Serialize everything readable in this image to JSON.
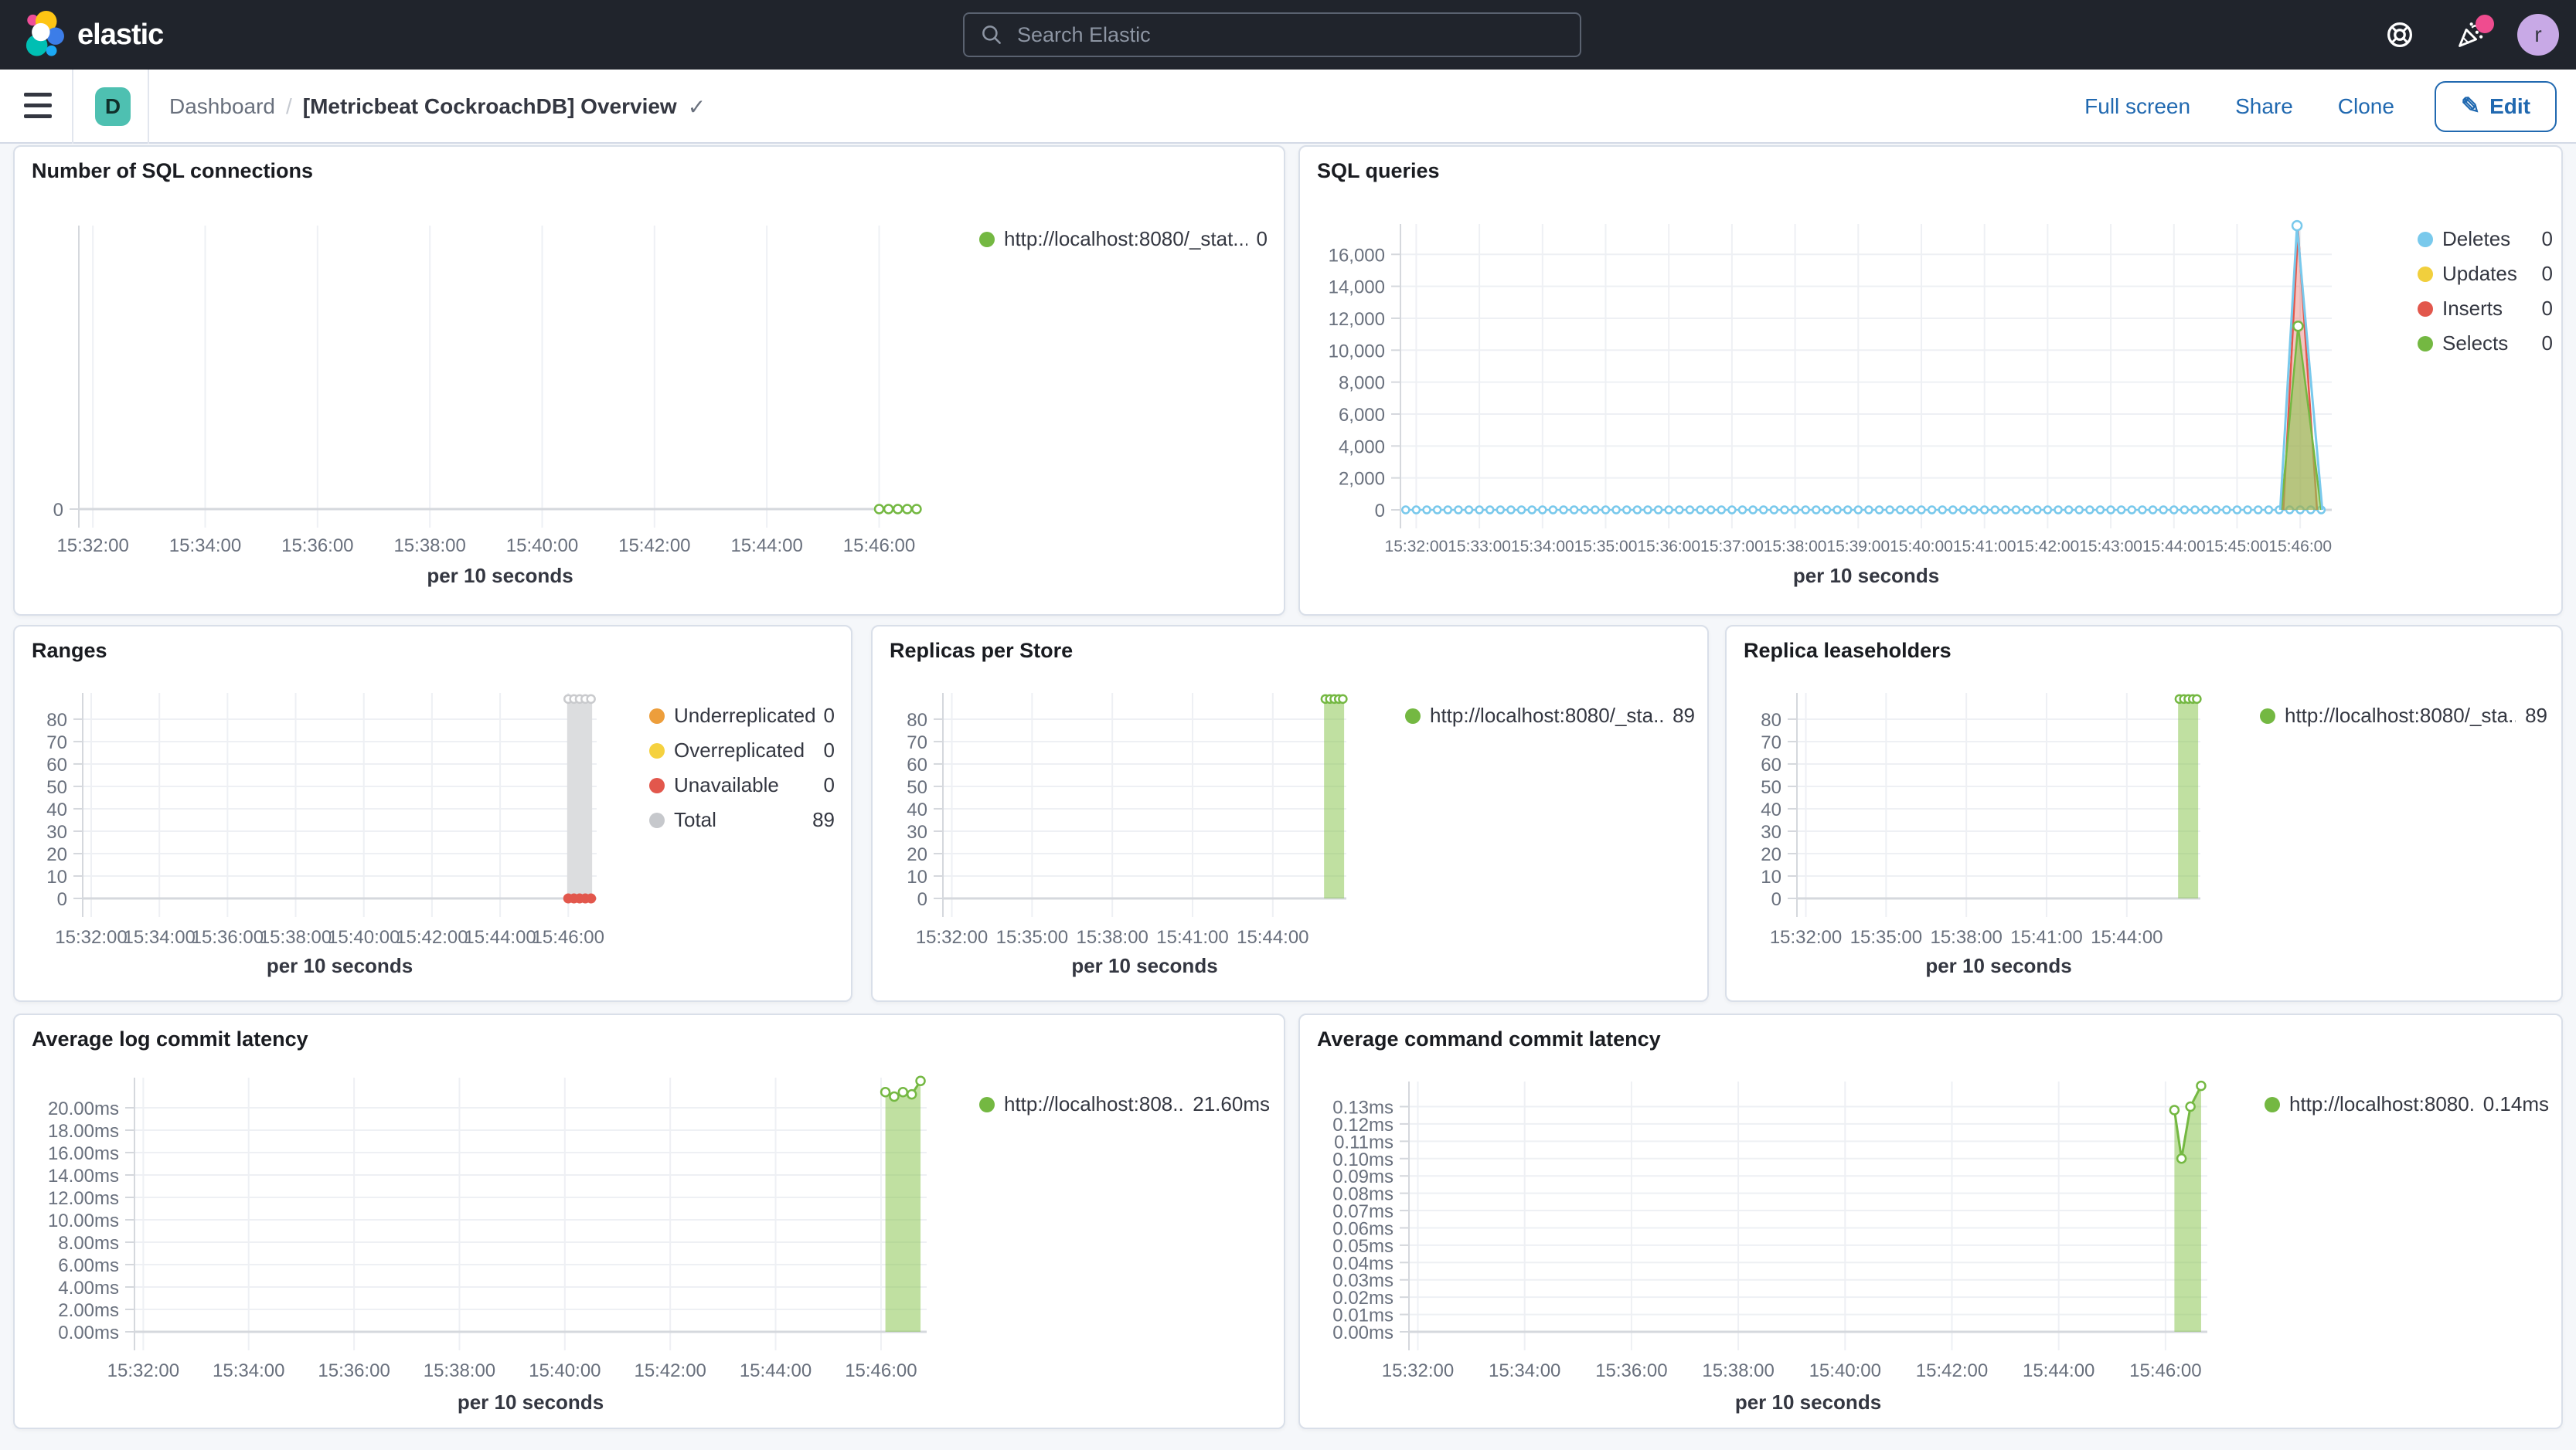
{
  "header": {
    "brand": "elastic",
    "search_placeholder": "Search Elastic",
    "avatar_initial": "r"
  },
  "toolbar": {
    "space_initial": "D",
    "breadcrumb_root": "Dashboard",
    "breadcrumb_sep": "/",
    "title": "[Metricbeat CockroachDB] Overview",
    "title_check": "✓",
    "full_screen_label": "Full screen",
    "share_label": "Share",
    "clone_label": "Clone",
    "edit_label": "Edit"
  },
  "panels": [
    {
      "id": "p-sql-conn",
      "title": "Number of SQL connections",
      "x_axis_title": "per 10 seconds",
      "legend": [
        {
          "color": "#74b842",
          "label": "http://localhost:8080/_stat...",
          "value": "0"
        }
      ],
      "chart_data": {
        "type": "line",
        "x_domain": [
          "15:31:45",
          "15:46:45"
        ],
        "x_ticks": [
          "15:32:00",
          "15:34:00",
          "15:36:00",
          "15:38:00",
          "15:40:00",
          "15:42:00",
          "15:44:00",
          "15:46:00"
        ],
        "y_domain": [
          0,
          1
        ],
        "y_ticks": [
          {
            "label": "0",
            "v": 0
          }
        ],
        "series": [
          {
            "kind": "line",
            "color": "#74b842",
            "width": 3,
            "markers": true,
            "open": true,
            "points": [
              [
                "15:46:00",
                0
              ],
              [
                "15:46:10",
                0
              ],
              [
                "15:46:20",
                0
              ],
              [
                "15:46:30",
                0
              ],
              [
                "15:46:40",
                0
              ]
            ]
          }
        ]
      }
    },
    {
      "id": "p-sql-queries",
      "title": "SQL queries",
      "x_axis_title": "per 10 seconds",
      "legend": [
        {
          "color": "#79c9ec",
          "label": "Deletes",
          "value": "0"
        },
        {
          "color": "#f1cf3d",
          "label": "Updates",
          "value": "0"
        },
        {
          "color": "#e2574c",
          "label": "Inserts",
          "value": "0"
        },
        {
          "color": "#74b842",
          "label": "Selects",
          "value": "0"
        }
      ],
      "chart_data": {
        "type": "line",
        "x_domain": [
          "15:31:45",
          "15:46:30"
        ],
        "x_ticks": [
          "15:32:00",
          "15:33:00",
          "15:34:00",
          "15:35:00",
          "15:36:00",
          "15:37:00",
          "15:38:00",
          "15:39:00",
          "15:40:00",
          "15:41:00",
          "15:42:00",
          "15:43:00",
          "15:44:00",
          "15:45:00",
          "15:46:00"
        ],
        "y_domain": [
          0,
          17900
        ],
        "y_ticks": [
          {
            "label": "0",
            "v": 0
          },
          {
            "label": "2,000",
            "v": 2000
          },
          {
            "label": "4,000",
            "v": 4000
          },
          {
            "label": "6,000",
            "v": 6000
          },
          {
            "label": "8,000",
            "v": 8000
          },
          {
            "label": "10,000",
            "v": 10000
          },
          {
            "label": "12,000",
            "v": 12000
          },
          {
            "label": "14,000",
            "v": 14000
          },
          {
            "label": "16,000",
            "v": 16000
          }
        ],
        "series": [
          {
            "kind": "zero-dots",
            "color": "#79c9ec",
            "from": "15:31:50",
            "to": "15:46:20",
            "step": 10
          },
          {
            "kind": "area",
            "color": "#e2574c",
            "fill": "rgba(226,87,76,0.35)",
            "width": 2.5,
            "points": [
              [
                "15:45:44",
                0
              ],
              [
                "15:45:58",
                17500
              ],
              [
                "15:46:16",
                0
              ]
            ]
          },
          {
            "kind": "area",
            "color": "#74b842",
            "fill": "rgba(141,198,83,0.6)",
            "width": 2.5,
            "points": [
              [
                "15:45:42",
                0
              ],
              [
                "15:45:58",
                11500
              ],
              [
                "15:46:20",
                0
              ]
            ]
          },
          {
            "kind": "line",
            "color": "#79c9ec",
            "width": 3,
            "points": [
              [
                "15:45:41",
                0
              ],
              [
                "15:45:57",
                17800
              ],
              [
                "15:46:21",
                0
              ]
            ]
          },
          {
            "kind": "points",
            "color": "#f1cf3d",
            "open": false,
            "r": 4.5,
            "points": [
              [
                "15:45:57",
                17800
              ]
            ]
          },
          {
            "kind": "points",
            "color": "#79c9ec",
            "open": true,
            "r": 6,
            "points": [
              [
                "15:45:57",
                17800
              ]
            ]
          },
          {
            "kind": "points",
            "color": "#74b842",
            "open": true,
            "r": 6,
            "points": [
              [
                "15:45:58",
                11500
              ]
            ]
          }
        ]
      }
    },
    {
      "id": "p-ranges",
      "title": "Ranges",
      "x_axis_title": "per 10 seconds",
      "legend": [
        {
          "color": "#ed9e3b",
          "label": "Underreplicated",
          "value": "0"
        },
        {
          "color": "#f5d13f",
          "label": "Overreplicated",
          "value": "0"
        },
        {
          "color": "#e2574c",
          "label": "Unavailable",
          "value": "0"
        },
        {
          "color": "#c6c8cc",
          "label": "Total",
          "value": "89"
        }
      ],
      "chart_data": {
        "type": "bar",
        "x_domain": [
          "15:31:45",
          "15:46:50"
        ],
        "x_ticks": [
          "15:32:00",
          "15:34:00",
          "15:36:00",
          "15:38:00",
          "15:40:00",
          "15:42:00",
          "15:44:00",
          "15:46:00"
        ],
        "y_domain": [
          0,
          91.7
        ],
        "y_ticks": [
          {
            "label": "0",
            "v": 0
          },
          {
            "label": "10",
            "v": 10
          },
          {
            "label": "20",
            "v": 20
          },
          {
            "label": "30",
            "v": 30
          },
          {
            "label": "40",
            "v": 40
          },
          {
            "label": "50",
            "v": 50
          },
          {
            "label": "60",
            "v": 60
          },
          {
            "label": "70",
            "v": 70
          },
          {
            "label": "80",
            "v": 80
          }
        ],
        "series": [
          {
            "kind": "bar",
            "fill": "#dcdddf",
            "from": "15:45:58",
            "to": "15:46:42",
            "value": 89
          },
          {
            "kind": "points",
            "color": "#c9cacd",
            "open": true,
            "r": 5,
            "points": [
              [
                "15:46:00",
                89
              ],
              [
                "15:46:10",
                89
              ],
              [
                "15:46:20",
                89
              ],
              [
                "15:46:30",
                89
              ],
              [
                "15:46:40",
                89
              ]
            ]
          },
          {
            "kind": "points",
            "color": "#e2574c",
            "open": false,
            "r": 6.5,
            "points": [
              [
                "15:46:00",
                0
              ],
              [
                "15:46:10",
                0
              ],
              [
                "15:46:20",
                0
              ],
              [
                "15:46:30",
                0
              ],
              [
                "15:46:40",
                0
              ]
            ]
          }
        ]
      }
    },
    {
      "id": "p-replicas",
      "title": "Replicas per Store",
      "x_axis_title": "per 10 seconds",
      "legend": [
        {
          "color": "#74b842",
          "label": "http://localhost:8080/_sta...",
          "value": "89"
        }
      ],
      "chart_data": {
        "type": "bar",
        "x_domain": [
          "15:31:40",
          "15:46:45"
        ],
        "x_ticks": [
          "15:32:00",
          "15:35:00",
          "15:38:00",
          "15:41:00",
          "15:44:00"
        ],
        "y_domain": [
          0,
          91.7
        ],
        "y_ticks": [
          {
            "label": "0",
            "v": 0
          },
          {
            "label": "10",
            "v": 10
          },
          {
            "label": "20",
            "v": 20
          },
          {
            "label": "30",
            "v": 30
          },
          {
            "label": "40",
            "v": 40
          },
          {
            "label": "50",
            "v": 50
          },
          {
            "label": "60",
            "v": 60
          },
          {
            "label": "70",
            "v": 70
          },
          {
            "label": "80",
            "v": 80
          }
        ],
        "series": [
          {
            "kind": "bar",
            "fill": "rgba(141,198,83,0.55)",
            "from": "15:45:55",
            "to": "15:46:40",
            "value": 89
          },
          {
            "kind": "points",
            "color": "#74b842",
            "open": true,
            "r": 5,
            "points": [
              [
                "15:45:58",
                89
              ],
              [
                "15:46:08",
                89
              ],
              [
                "15:46:18",
                89
              ],
              [
                "15:46:28",
                89
              ],
              [
                "15:46:37",
                89
              ]
            ]
          }
        ]
      }
    },
    {
      "id": "p-leaseholders",
      "title": "Replica leaseholders",
      "x_axis_title": "per 10 seconds",
      "legend": [
        {
          "color": "#74b842",
          "label": "http://localhost:8080/_sta...",
          "value": "89"
        }
      ],
      "chart_data": {
        "type": "bar",
        "x_domain": [
          "15:31:40",
          "15:46:45"
        ],
        "x_ticks": [
          "15:32:00",
          "15:35:00",
          "15:38:00",
          "15:41:00",
          "15:44:00"
        ],
        "y_domain": [
          0,
          91.7
        ],
        "y_ticks": [
          {
            "label": "0",
            "v": 0
          },
          {
            "label": "10",
            "v": 10
          },
          {
            "label": "20",
            "v": 20
          },
          {
            "label": "30",
            "v": 30
          },
          {
            "label": "40",
            "v": 40
          },
          {
            "label": "50",
            "v": 50
          },
          {
            "label": "60",
            "v": 60
          },
          {
            "label": "70",
            "v": 70
          },
          {
            "label": "80",
            "v": 80
          }
        ],
        "series": [
          {
            "kind": "bar",
            "fill": "rgba(141,198,83,0.55)",
            "from": "15:45:55",
            "to": "15:46:40",
            "value": 89
          },
          {
            "kind": "points",
            "color": "#74b842",
            "open": true,
            "r": 5,
            "points": [
              [
                "15:45:58",
                89
              ],
              [
                "15:46:08",
                89
              ],
              [
                "15:46:18",
                89
              ],
              [
                "15:46:28",
                89
              ],
              [
                "15:46:37",
                89
              ]
            ]
          }
        ]
      }
    },
    {
      "id": "p-log-lat",
      "title": "Average log commit latency",
      "x_axis_title": "per 10 seconds",
      "legend": [
        {
          "color": "#74b842",
          "label": "http://localhost:808...",
          "value": "21.60ms"
        }
      ],
      "chart_data": {
        "type": "area",
        "x_domain": [
          "15:31:50",
          "15:46:52"
        ],
        "x_ticks": [
          "15:32:00",
          "15:34:00",
          "15:36:00",
          "15:38:00",
          "15:40:00",
          "15:42:00",
          "15:44:00",
          "15:46:00"
        ],
        "y_domain": [
          0,
          22.69
        ],
        "y_ticks": [
          {
            "label": "0.00ms",
            "v": 0
          },
          {
            "label": "2.00ms",
            "v": 2
          },
          {
            "label": "4.00ms",
            "v": 4
          },
          {
            "label": "6.00ms",
            "v": 6
          },
          {
            "label": "8.00ms",
            "v": 8
          },
          {
            "label": "10.00ms",
            "v": 10
          },
          {
            "label": "12.00ms",
            "v": 12
          },
          {
            "label": "14.00ms",
            "v": 14
          },
          {
            "label": "16.00ms",
            "v": 16
          },
          {
            "label": "18.00ms",
            "v": 18
          },
          {
            "label": "20.00ms",
            "v": 20
          }
        ],
        "series": [
          {
            "kind": "area",
            "color": "#74b842",
            "fill": "rgba(141,198,83,0.55)",
            "width": 3,
            "markers": true,
            "open": true,
            "points": [
              [
                "15:46:05",
                21.4
              ],
              [
                "15:46:15",
                21.0
              ],
              [
                "15:46:25",
                21.4
              ],
              [
                "15:46:35",
                21.2
              ],
              [
                "15:46:45",
                22.4
              ]
            ]
          }
        ]
      }
    },
    {
      "id": "p-cmd-lat",
      "title": "Average command commit latency",
      "x_axis_title": "per 10 seconds",
      "legend": [
        {
          "color": "#74b842",
          "label": "http://localhost:8080...",
          "value": "0.14ms"
        }
      ],
      "chart_data": {
        "type": "area",
        "x_domain": [
          "15:31:50",
          "15:46:47"
        ],
        "x_ticks": [
          "15:32:00",
          "15:34:00",
          "15:36:00",
          "15:38:00",
          "15:40:00",
          "15:42:00",
          "15:44:00",
          "15:46:00"
        ],
        "y_domain": [
          0,
          0.1445
        ],
        "y_ticks": [
          {
            "label": "0.00ms",
            "v": 0
          },
          {
            "label": "0.01ms",
            "v": 0.01
          },
          {
            "label": "0.02ms",
            "v": 0.02
          },
          {
            "label": "0.03ms",
            "v": 0.03
          },
          {
            "label": "0.04ms",
            "v": 0.04
          },
          {
            "label": "0.05ms",
            "v": 0.05
          },
          {
            "label": "0.06ms",
            "v": 0.06
          },
          {
            "label": "0.07ms",
            "v": 0.07
          },
          {
            "label": "0.08ms",
            "v": 0.08
          },
          {
            "label": "0.09ms",
            "v": 0.09
          },
          {
            "label": "0.10ms",
            "v": 0.1
          },
          {
            "label": "0.11ms",
            "v": 0.11
          },
          {
            "label": "0.12ms",
            "v": 0.12
          },
          {
            "label": "0.13ms",
            "v": 0.13
          }
        ],
        "series": [
          {
            "kind": "area",
            "color": "#74b842",
            "fill": "rgba(141,198,83,0.55)",
            "width": 3,
            "markers": true,
            "open": true,
            "points": [
              [
                "15:46:10",
                0.128
              ],
              [
                "15:46:18",
                0.1
              ],
              [
                "15:46:28",
                0.13
              ],
              [
                "15:46:40",
                0.142
              ]
            ]
          }
        ]
      }
    }
  ]
}
